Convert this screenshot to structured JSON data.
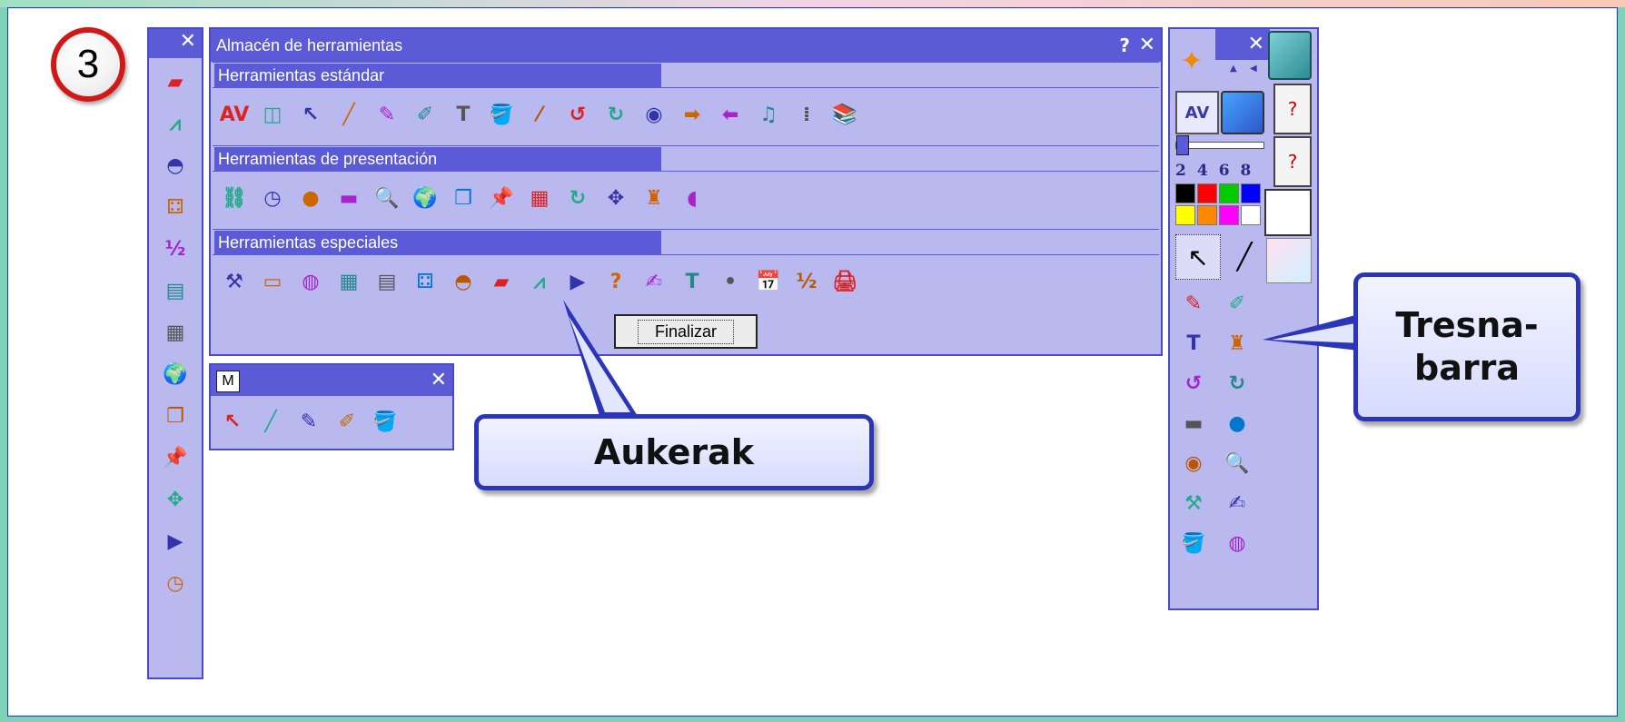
{
  "step_number": "3",
  "store_panel": {
    "title": "Almacén de herramientas",
    "help": "?",
    "close": "✕",
    "sections": [
      {
        "header": "Herramientas estándar",
        "tools": [
          "AV",
          "◫",
          "↖",
          "╱",
          "✎",
          "✐",
          "T",
          "🪣",
          "⁄",
          "↺",
          "↻",
          "◉",
          "➡",
          "⬅",
          "♫",
          "⁞",
          "📚"
        ]
      },
      {
        "header": "Herramientas de presentación",
        "tools": [
          "⛓",
          "◷",
          "●",
          "▬",
          "🔍",
          "🌍",
          "❐",
          "📌",
          "▦",
          "↻",
          "✥",
          "♜",
          "◖"
        ]
      },
      {
        "header": "Herramientas especiales",
        "tools": [
          "⚒",
          "▭",
          "◍",
          "▦",
          "▤",
          "⚃",
          "◓",
          "▰",
          "⩘",
          "▶",
          "?",
          "✍",
          "T",
          "•",
          "📅",
          "½",
          "🖨"
        ]
      }
    ],
    "finish_button": "Finalizar"
  },
  "left_toolbar": {
    "close": "✕",
    "tools": [
      "▰",
      "⩘",
      "◓",
      "⚃",
      "½",
      "▤",
      "▦",
      "🌍",
      "❐",
      "📌",
      "✥",
      "▶",
      "◷"
    ]
  },
  "mini_toolbar": {
    "badge": "M",
    "close": "✕",
    "tools": [
      "↖",
      "╱",
      "✎",
      "✐",
      "🪣"
    ]
  },
  "right_toolbar": {
    "close": "✕",
    "up_arrow": "▲",
    "left_arrow": "◀",
    "pen_sizes": [
      "2",
      "4",
      "6",
      "8"
    ],
    "colors": [
      "#000000",
      "#ff0000",
      "#00cc00",
      "#0000ff",
      "#ffff00",
      "#ff8800",
      "#ff00ff",
      "#ffffff"
    ],
    "rows": [
      [
        "✎",
        "✐"
      ],
      [
        "T",
        "♜"
      ],
      [
        "↺",
        "↻"
      ],
      [
        "▬",
        "●"
      ],
      [
        "◉",
        "🔍"
      ],
      [
        "⚒",
        "✍"
      ],
      [
        "🪣",
        "◍"
      ]
    ]
  },
  "callouts": {
    "aukerak": "Aukerak",
    "tresnabarra_line1": "Tresna-",
    "tresnabarra_line2": "barra"
  },
  "colors": {
    "panel_bg": "#b9b9f0",
    "title_bg": "#5b5bd8",
    "callout_border": "#2b35b8",
    "step_ring": "#d01818"
  }
}
